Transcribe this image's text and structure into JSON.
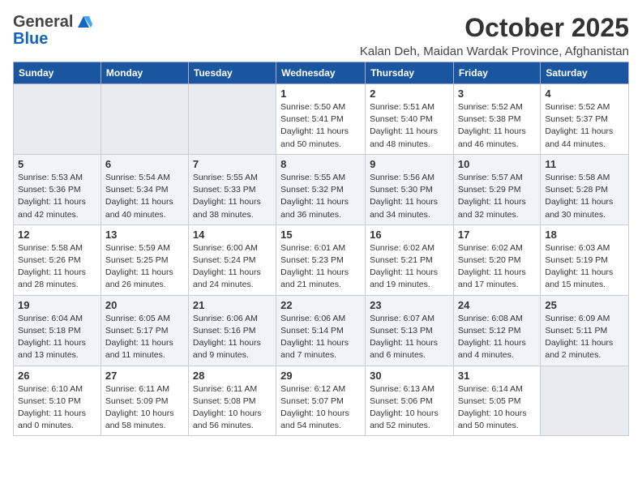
{
  "header": {
    "logo_general": "General",
    "logo_blue": "Blue",
    "month_title": "October 2025",
    "location": "Kalan Deh, Maidan Wardak Province, Afghanistan"
  },
  "days_of_week": [
    "Sunday",
    "Monday",
    "Tuesday",
    "Wednesday",
    "Thursday",
    "Friday",
    "Saturday"
  ],
  "weeks": [
    [
      {
        "day": "",
        "info": ""
      },
      {
        "day": "",
        "info": ""
      },
      {
        "day": "",
        "info": ""
      },
      {
        "day": "1",
        "info": "Sunrise: 5:50 AM\nSunset: 5:41 PM\nDaylight: 11 hours\nand 50 minutes."
      },
      {
        "day": "2",
        "info": "Sunrise: 5:51 AM\nSunset: 5:40 PM\nDaylight: 11 hours\nand 48 minutes."
      },
      {
        "day": "3",
        "info": "Sunrise: 5:52 AM\nSunset: 5:38 PM\nDaylight: 11 hours\nand 46 minutes."
      },
      {
        "day": "4",
        "info": "Sunrise: 5:52 AM\nSunset: 5:37 PM\nDaylight: 11 hours\nand 44 minutes."
      }
    ],
    [
      {
        "day": "5",
        "info": "Sunrise: 5:53 AM\nSunset: 5:36 PM\nDaylight: 11 hours\nand 42 minutes."
      },
      {
        "day": "6",
        "info": "Sunrise: 5:54 AM\nSunset: 5:34 PM\nDaylight: 11 hours\nand 40 minutes."
      },
      {
        "day": "7",
        "info": "Sunrise: 5:55 AM\nSunset: 5:33 PM\nDaylight: 11 hours\nand 38 minutes."
      },
      {
        "day": "8",
        "info": "Sunrise: 5:55 AM\nSunset: 5:32 PM\nDaylight: 11 hours\nand 36 minutes."
      },
      {
        "day": "9",
        "info": "Sunrise: 5:56 AM\nSunset: 5:30 PM\nDaylight: 11 hours\nand 34 minutes."
      },
      {
        "day": "10",
        "info": "Sunrise: 5:57 AM\nSunset: 5:29 PM\nDaylight: 11 hours\nand 32 minutes."
      },
      {
        "day": "11",
        "info": "Sunrise: 5:58 AM\nSunset: 5:28 PM\nDaylight: 11 hours\nand 30 minutes."
      }
    ],
    [
      {
        "day": "12",
        "info": "Sunrise: 5:58 AM\nSunset: 5:26 PM\nDaylight: 11 hours\nand 28 minutes."
      },
      {
        "day": "13",
        "info": "Sunrise: 5:59 AM\nSunset: 5:25 PM\nDaylight: 11 hours\nand 26 minutes."
      },
      {
        "day": "14",
        "info": "Sunrise: 6:00 AM\nSunset: 5:24 PM\nDaylight: 11 hours\nand 24 minutes."
      },
      {
        "day": "15",
        "info": "Sunrise: 6:01 AM\nSunset: 5:23 PM\nDaylight: 11 hours\nand 21 minutes."
      },
      {
        "day": "16",
        "info": "Sunrise: 6:02 AM\nSunset: 5:21 PM\nDaylight: 11 hours\nand 19 minutes."
      },
      {
        "day": "17",
        "info": "Sunrise: 6:02 AM\nSunset: 5:20 PM\nDaylight: 11 hours\nand 17 minutes."
      },
      {
        "day": "18",
        "info": "Sunrise: 6:03 AM\nSunset: 5:19 PM\nDaylight: 11 hours\nand 15 minutes."
      }
    ],
    [
      {
        "day": "19",
        "info": "Sunrise: 6:04 AM\nSunset: 5:18 PM\nDaylight: 11 hours\nand 13 minutes."
      },
      {
        "day": "20",
        "info": "Sunrise: 6:05 AM\nSunset: 5:17 PM\nDaylight: 11 hours\nand 11 minutes."
      },
      {
        "day": "21",
        "info": "Sunrise: 6:06 AM\nSunset: 5:16 PM\nDaylight: 11 hours\nand 9 minutes."
      },
      {
        "day": "22",
        "info": "Sunrise: 6:06 AM\nSunset: 5:14 PM\nDaylight: 11 hours\nand 7 minutes."
      },
      {
        "day": "23",
        "info": "Sunrise: 6:07 AM\nSunset: 5:13 PM\nDaylight: 11 hours\nand 6 minutes."
      },
      {
        "day": "24",
        "info": "Sunrise: 6:08 AM\nSunset: 5:12 PM\nDaylight: 11 hours\nand 4 minutes."
      },
      {
        "day": "25",
        "info": "Sunrise: 6:09 AM\nSunset: 5:11 PM\nDaylight: 11 hours\nand 2 minutes."
      }
    ],
    [
      {
        "day": "26",
        "info": "Sunrise: 6:10 AM\nSunset: 5:10 PM\nDaylight: 11 hours\nand 0 minutes."
      },
      {
        "day": "27",
        "info": "Sunrise: 6:11 AM\nSunset: 5:09 PM\nDaylight: 10 hours\nand 58 minutes."
      },
      {
        "day": "28",
        "info": "Sunrise: 6:11 AM\nSunset: 5:08 PM\nDaylight: 10 hours\nand 56 minutes."
      },
      {
        "day": "29",
        "info": "Sunrise: 6:12 AM\nSunset: 5:07 PM\nDaylight: 10 hours\nand 54 minutes."
      },
      {
        "day": "30",
        "info": "Sunrise: 6:13 AM\nSunset: 5:06 PM\nDaylight: 10 hours\nand 52 minutes."
      },
      {
        "day": "31",
        "info": "Sunrise: 6:14 AM\nSunset: 5:05 PM\nDaylight: 10 hours\nand 50 minutes."
      },
      {
        "day": "",
        "info": ""
      }
    ]
  ]
}
